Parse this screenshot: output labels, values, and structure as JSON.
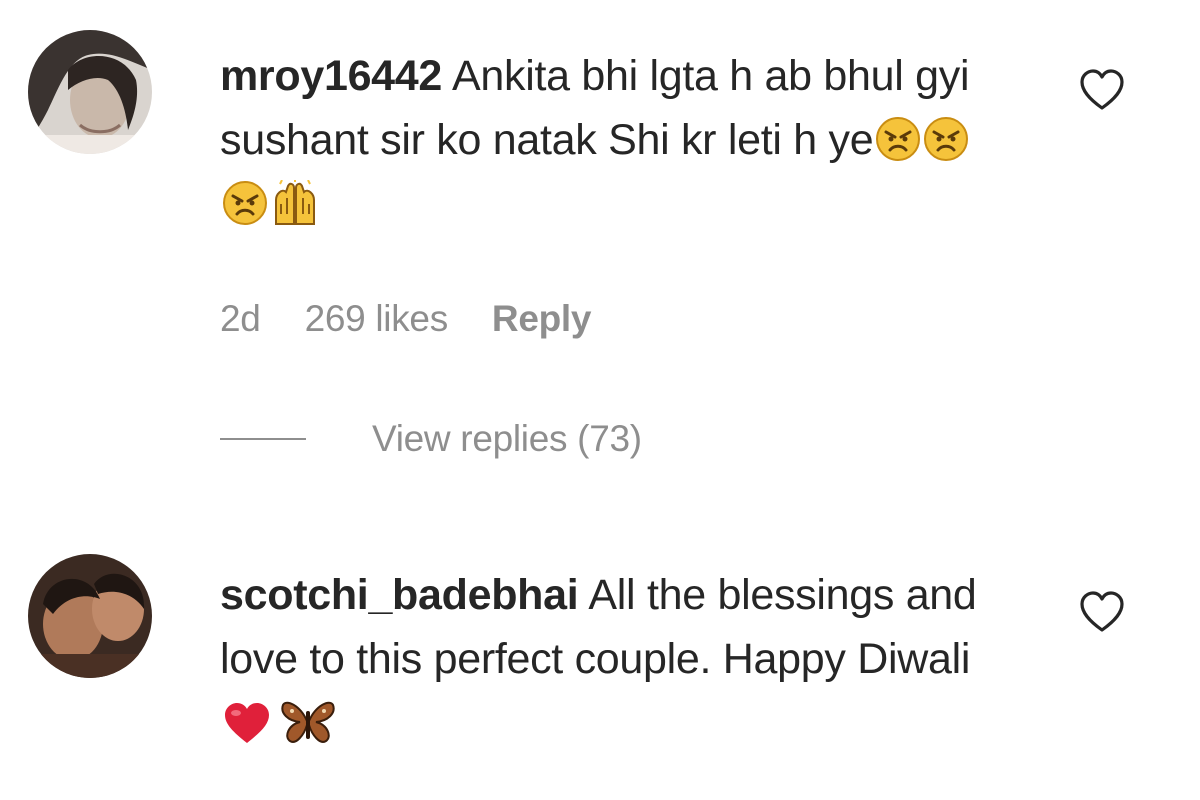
{
  "comments": [
    {
      "username": "mroy16442",
      "text": "Ankita bhi lgta h ab bhul gyi sushant sir ko natak Shi kr leti h ye",
      "emojis": [
        "angry-face",
        "angry-face",
        "angry-face",
        "raising-hands"
      ],
      "time": "2d",
      "likes": "269 likes",
      "reply_label": "Reply",
      "view_replies": "View replies (73)"
    },
    {
      "username": "scotchi_badebhai",
      "text": "All the blessings and love to this perfect couple. Happy Diwali",
      "emojis": [
        "red-heart",
        "butterfly"
      ]
    }
  ],
  "colors": {
    "text": "#262626",
    "muted": "#8e8e8e",
    "heart_outline": "#262626",
    "emoji_yellow": "#f5c33b",
    "heart_red": "#e0203a",
    "butterfly_brown": "#a0582a"
  }
}
